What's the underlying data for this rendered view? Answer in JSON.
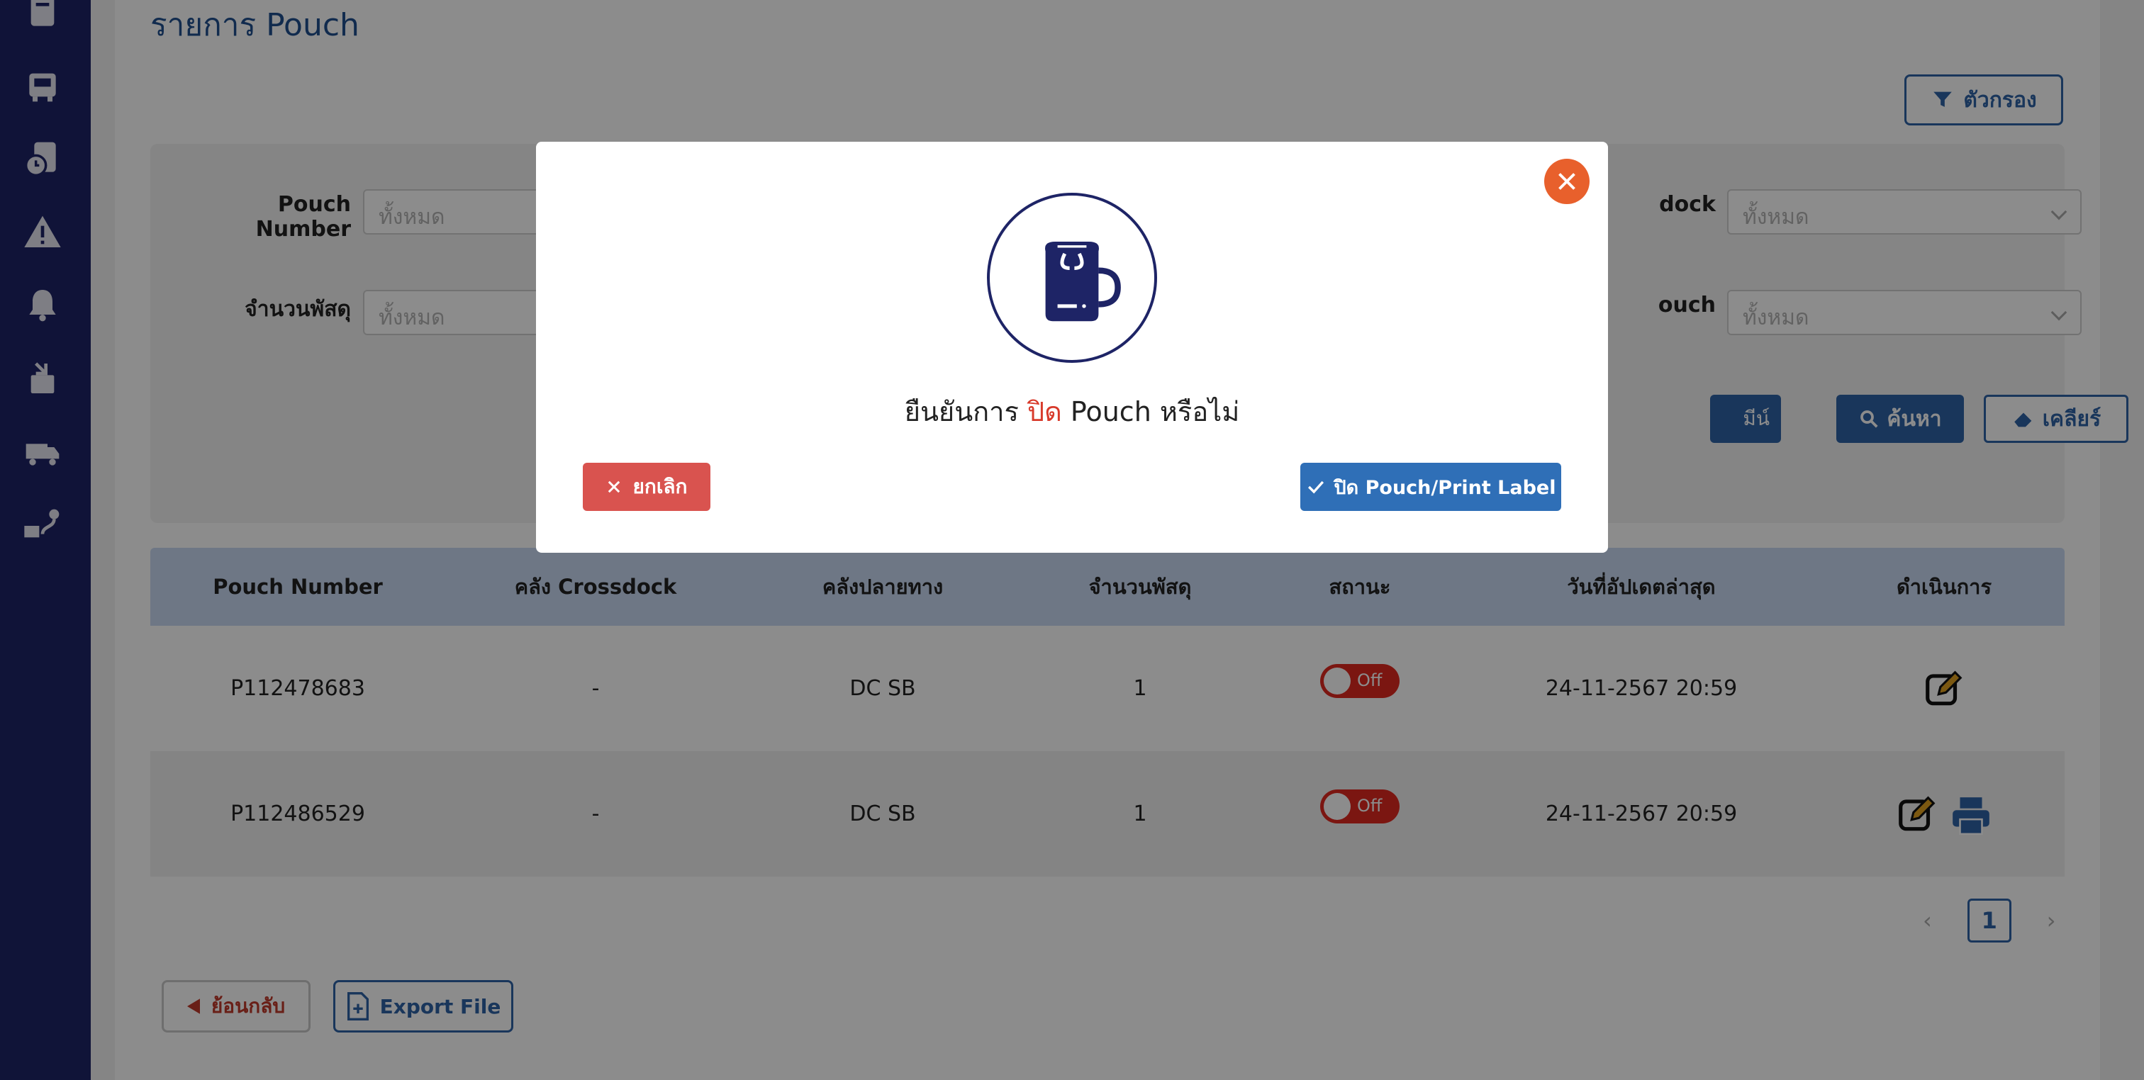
{
  "page": {
    "title": "รายการ Pouch",
    "filter_button": "ตัวกรอง"
  },
  "filters": {
    "pouch_number_label": "Pouch Number",
    "pouch_number_placeholder": "ทั้งหมด",
    "parcel_count_label": "จำนวนพัสดุ",
    "parcel_count_placeholder": "ทั้งหมด",
    "crossdock_label_partial": "dock",
    "crossdock_placeholder": "ทั้งหมด",
    "pouch_status_label_partial": "ouch",
    "pouch_status_placeholder": "ทั้งหมด",
    "mini_select_partial": "มีน์",
    "search_button": "ค้นหา",
    "clear_button": "เคลียร์"
  },
  "table": {
    "headers": [
      "Pouch Number",
      "คลัง Crossdock",
      "คลังปลายทาง",
      "จำนวนพัสดุ",
      "สถานะ",
      "วันที่อัปเดตล่าสุด",
      "ดำเนินการ"
    ],
    "rows": [
      {
        "pouch": "P112478683",
        "crossdock": "-",
        "destination": "DC SB",
        "count": "1",
        "status": "Off",
        "updated": "24-11-2567 20:59"
      },
      {
        "pouch": "P112486529",
        "crossdock": "-",
        "destination": "DC SB",
        "count": "1",
        "status": "Off",
        "updated": "24-11-2567 20:59"
      }
    ]
  },
  "pagination": {
    "current": "1",
    "prev": "‹",
    "next": "›"
  },
  "footer": {
    "back_button": "ย้อนกลับ",
    "export_button": "Export File"
  },
  "modal": {
    "text_before": "ยืนยันการ ",
    "text_highlight": "ปิด",
    "text_after": " Pouch หรือไม่",
    "cancel_button": "ยกเลิก",
    "confirm_button": "ปิด Pouch/Print Label"
  },
  "colors": {
    "sidebar": "#1e2466",
    "primary": "#2f63a6",
    "danger": "#d9534f",
    "close": "#e8602c"
  }
}
